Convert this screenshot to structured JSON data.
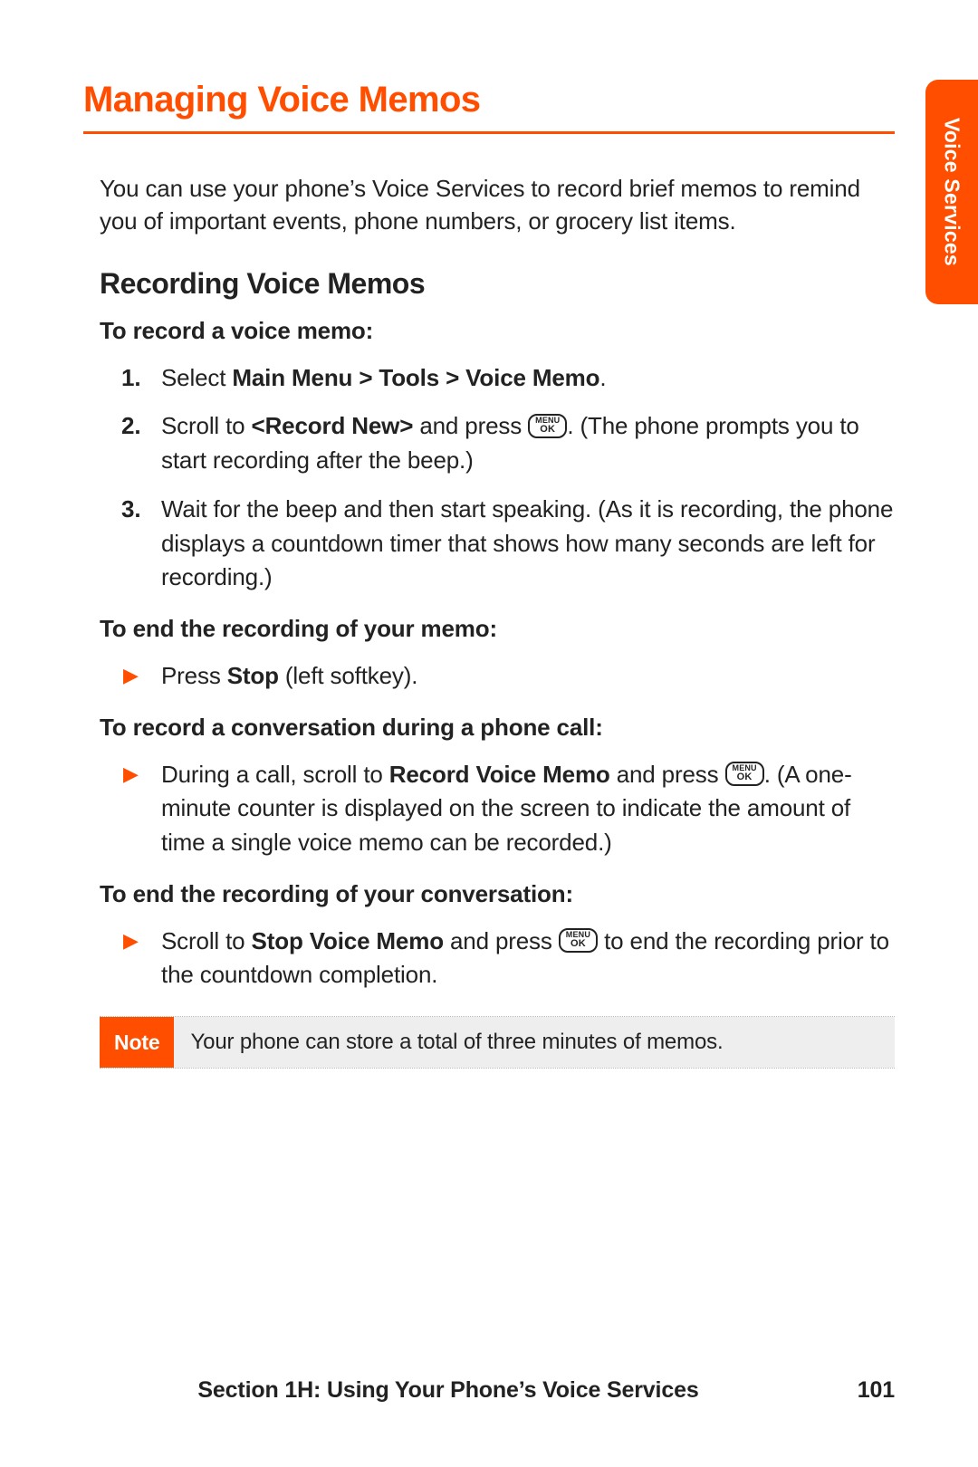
{
  "side_tab": "Voice Services",
  "h1": "Managing Voice Memos",
  "intro": "You can use your phone’s Voice Services to record brief memos to remind you of important events, phone numbers, or grocery list items.",
  "h2": "Recording Voice Memos",
  "lead1": "To record a voice memo:",
  "steps": {
    "s1_pre": "Select ",
    "s1_bold": "Main Menu > Tools > Voice Memo",
    "s1_post": ".",
    "s2_pre": "Scroll to ",
    "s2_bold": "<Record New>",
    "s2_mid": " and press ",
    "s2_post": ". (The phone prompts you to start recording after the beep.)",
    "s3": "Wait for the beep and then start speaking. (As it is recording, the phone displays a countdown timer that shows how many seconds are left for recording.)"
  },
  "lead2": "To end the recording of your memo:",
  "bullet2_pre": "Press ",
  "bullet2_bold": "Stop",
  "bullet2_post": " (left softkey).",
  "lead3": "To record a conversation during a phone call:",
  "bullet3_pre": "During a call, scroll to ",
  "bullet3_bold": "Record Voice Memo",
  "bullet3_mid": " and press ",
  "bullet3_post": ". (A one-minute counter is displayed on the screen to  indicate the amount of time a single voice memo can be recorded.)",
  "lead4": "To end the recording of your conversation:",
  "bullet4_pre": "Scroll to ",
  "bullet4_bold": "Stop Voice Memo",
  "bullet4_mid": " and press ",
  "bullet4_post": " to end the recording prior to the countdown completion.",
  "note_label": "Note",
  "note_text": "Your phone can store a total of three minutes of memos.",
  "footer_section": "Section 1H: Using Your Phone’s Voice Services",
  "page_number": "101",
  "key": {
    "top": "MENU",
    "bottom": "OK"
  }
}
